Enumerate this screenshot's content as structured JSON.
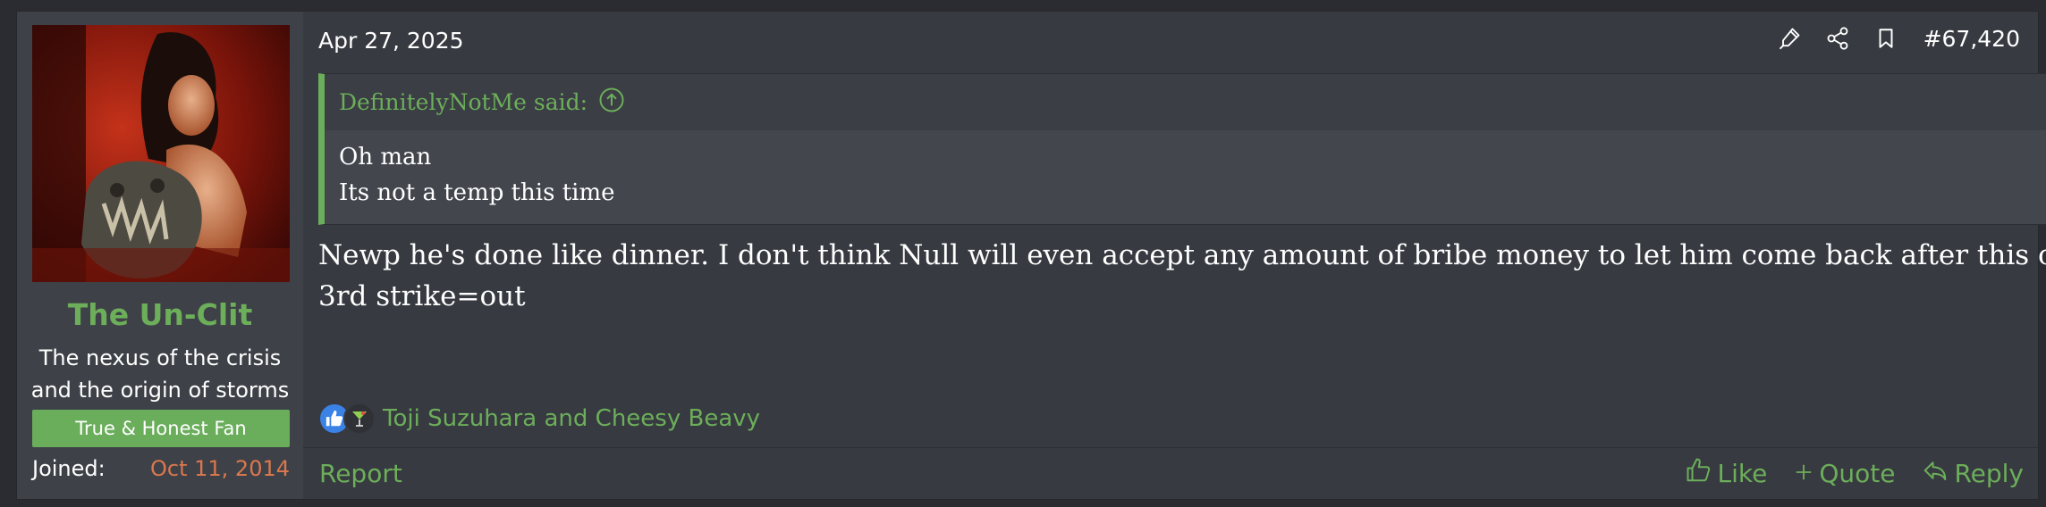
{
  "user": {
    "username": "The Un-Clit",
    "title_line1": "The nexus of the crisis",
    "title_line2": "and the origin of storms",
    "banner": "True & Honest Fan",
    "joined_label": "Joined:",
    "joined_date": "Oct 11, 2014"
  },
  "post": {
    "date": "Apr 27, 2025",
    "number": "#67,420",
    "quote": {
      "author_said": "DefinitelyNotMe said:",
      "line1": "Oh man",
      "line2": "Its not a temp this time"
    },
    "message_line1": "Newp he's done like dinner. I don't think Null will even accept any amount of bribe money to let him come back after this one.",
    "message_line2": "3rd strike=out",
    "reactions": {
      "icons": [
        "like-icon",
        "cocktail-icon"
      ],
      "names": "Toji Suzuhara and Cheesy Beavy"
    }
  },
  "footer": {
    "report": "Report",
    "like": "Like",
    "quote": "Quote",
    "reply": "Reply"
  },
  "colors": {
    "accent_green": "#6aad5b",
    "joined_date": "#d9784e",
    "post_bg": "#373a40",
    "user_bg": "#3e4147"
  }
}
